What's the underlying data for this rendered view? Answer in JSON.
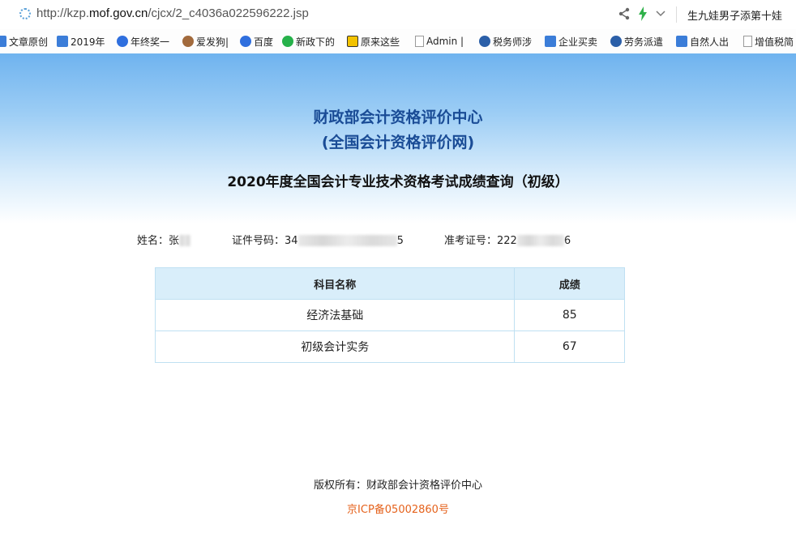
{
  "browser": {
    "url_prefix": "http://kzp.",
    "url_host": "mof.gov.cn",
    "url_path": "/cjcx/2_c4036a022596222.jsp",
    "news_headline": "生九娃男子添第十娃"
  },
  "bookmarks": [
    {
      "label": "文章原创",
      "icon": "blue-square-icon"
    },
    {
      "label": "2019年",
      "icon": "blue-square-icon"
    },
    {
      "label": "年终奖一",
      "icon": "baidu-paw-icon"
    },
    {
      "label": "爱发狗|",
      "icon": "dog-icon"
    },
    {
      "label": "百度",
      "icon": "baidu-paw-icon"
    },
    {
      "label": "新政下的",
      "icon": "wechat-icon"
    },
    {
      "label": "原来这些",
      "icon": "sogou-icon"
    },
    {
      "label": "Admin |",
      "icon": "page-icon"
    },
    {
      "label": "税务师涉",
      "icon": "round-logo-icon"
    },
    {
      "label": "企业买卖",
      "icon": "blue-square-icon"
    },
    {
      "label": "劳务派遣",
      "icon": "round-logo-icon"
    },
    {
      "label": "自然人出",
      "icon": "blue-square-icon"
    },
    {
      "label": "增值税简",
      "icon": "page-icon"
    }
  ],
  "header": {
    "org_name": "财政部会计资格评价中心",
    "org_subname": "(全国会计资格评价网)",
    "exam_title": "2020年度全国会计专业技术资格考试成绩查询（初级）"
  },
  "candidate": {
    "name_label": "姓名：",
    "name_visible": "张",
    "id_label": "证件号码：",
    "id_start": "34",
    "id_end": "5",
    "ticket_label": "准考证号：",
    "ticket_start": "222",
    "ticket_end": "6"
  },
  "scores": {
    "headers": [
      "科目名称",
      "成绩"
    ],
    "rows": [
      {
        "subject": "经济法基础",
        "score": "85"
      },
      {
        "subject": "初级会计实务",
        "score": "67"
      }
    ]
  },
  "footer": {
    "copyright": "版权所有：财政部会计资格评价中心",
    "icp": "京ICP备05002860号"
  },
  "colors": {
    "title_blue": "#1a4c96",
    "icp_orange": "#e5621c",
    "table_header_bg": "#d9eefa"
  }
}
